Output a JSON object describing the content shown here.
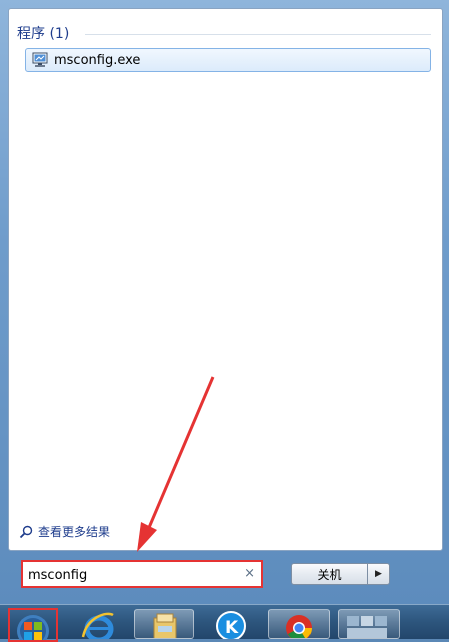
{
  "menu": {
    "section_title": "程序 (1)",
    "results": [
      {
        "label": "msconfig.exe",
        "icon": "msconfig-monitor-icon"
      }
    ],
    "see_more": "查看更多结果"
  },
  "search": {
    "value": "msconfig",
    "clear_glyph": "×"
  },
  "shutdown": {
    "label": "关机",
    "arrow_glyph": "▶"
  },
  "taskbar": {
    "items": [
      "start-orb-icon",
      "internet-explorer-icon",
      "file-explorer-icon",
      "kugou-icon",
      "chrome-icon",
      "window-thumbnail-icon"
    ]
  },
  "colors": {
    "accent": "#1e3c8c",
    "annotation": "#e53333",
    "highlight_border": "#84b3e6"
  }
}
